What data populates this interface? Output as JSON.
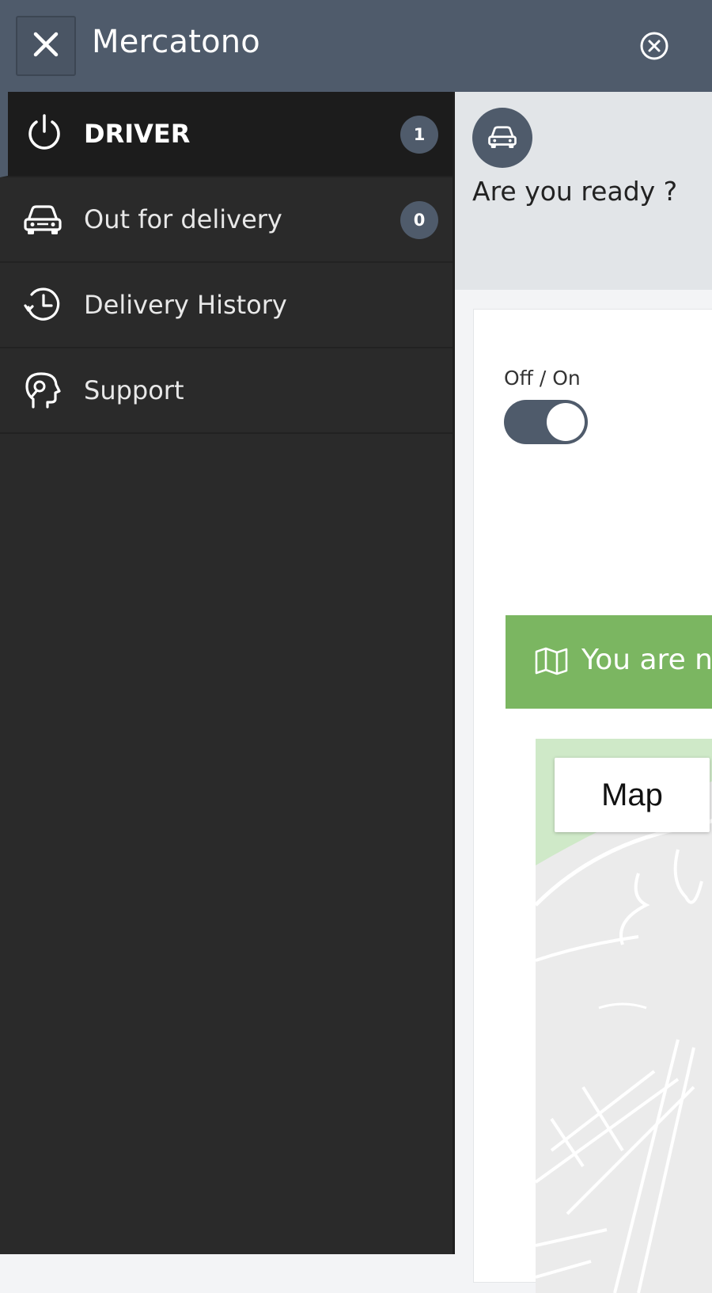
{
  "header": {
    "title": "Mercatono",
    "close_icon": "close-icon",
    "dismiss_icon": "circle-close-icon",
    "background": "#4f5b6b"
  },
  "sidebar": {
    "items": [
      {
        "label": "DRIVER",
        "icon": "power-icon",
        "badge": "1",
        "active": true
      },
      {
        "label": "Out for delivery",
        "icon": "car-icon",
        "badge": "0",
        "active": false
      },
      {
        "label": "Delivery History",
        "icon": "history-icon",
        "badge": "",
        "active": false
      },
      {
        "label": "Support",
        "icon": "support-icon",
        "badge": "",
        "active": false
      }
    ],
    "background": "#2a2a2a"
  },
  "main": {
    "status_question": "Are you ready ?",
    "avatar_icon": "car-icon",
    "toggle": {
      "label": "Off / On",
      "on": true
    },
    "alert": {
      "text": "You are n",
      "icon": "map-icon",
      "color": "#7bb661"
    },
    "map": {
      "button_label": "Map"
    }
  }
}
